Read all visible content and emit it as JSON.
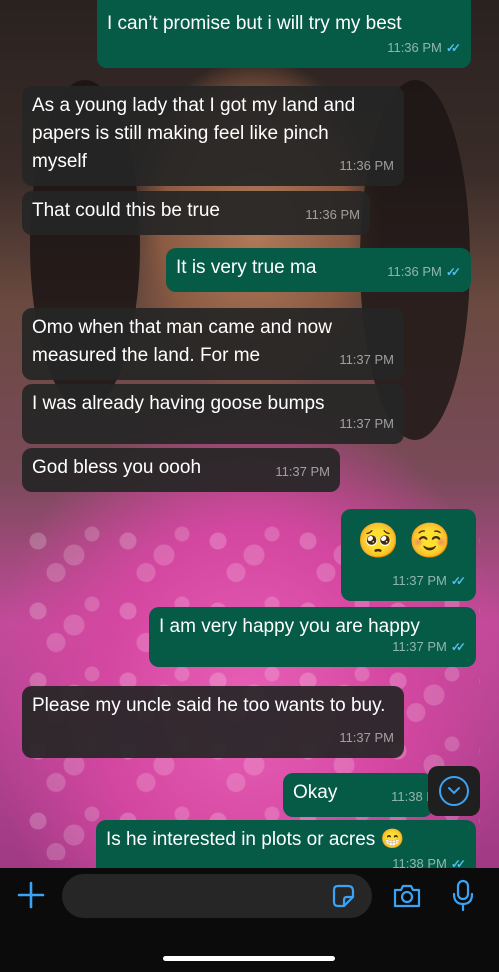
{
  "colors": {
    "outgoing_bubble": "#065b46",
    "incoming_bubble": "#262626",
    "read_ticks": "#53bdeb",
    "accent": "#3aa3f5"
  },
  "messages": [
    {
      "dir": "out",
      "text": "I can’t promise but i will try my best",
      "time": "11:36 PM",
      "ticks": "read"
    },
    {
      "dir": "in",
      "text": "As a young lady that I got my land and papers is still making feel like pinch myself",
      "time": "11:36 PM"
    },
    {
      "dir": "in",
      "text": "That could this be true",
      "time": "11:36 PM"
    },
    {
      "dir": "out",
      "text": "It is very true ma",
      "time": "11:36 PM",
      "ticks": "read"
    },
    {
      "dir": "in",
      "text": "Omo when that man came and now measured the land. For me",
      "time": "11:37 PM"
    },
    {
      "dir": "in",
      "text": "I was already having goose bumps",
      "time": "11:37 PM"
    },
    {
      "dir": "in",
      "text": "God bless you oooh",
      "time": "11:37 PM"
    },
    {
      "dir": "out",
      "text": "🥺 ☺️",
      "time": "11:37 PM",
      "ticks": "read"
    },
    {
      "dir": "out",
      "text": "I am very happy you are happy",
      "time": "11:37 PM",
      "ticks": "read"
    },
    {
      "dir": "in",
      "text": "Please my uncle said he too wants to buy.",
      "time": "11:37 PM"
    },
    {
      "dir": "out",
      "text": "Okay",
      "time": "11:38 P",
      "ticks": "read"
    },
    {
      "dir": "out",
      "text": "Is he interested in plots or acres 😁",
      "time": "11:38 PM",
      "ticks": "read"
    }
  ],
  "composer": {
    "placeholder": "",
    "icons": [
      "plus-icon",
      "sticker-icon",
      "camera-icon",
      "microphone-icon"
    ]
  },
  "scroll_button_icon": "chevron-down-icon"
}
